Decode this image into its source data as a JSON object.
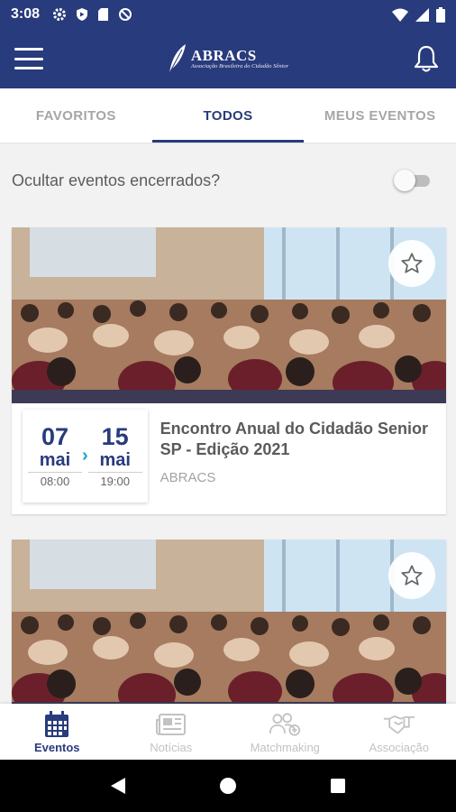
{
  "status_bar": {
    "time": "3:08"
  },
  "app_bar": {
    "logo_text": "ABRACS",
    "logo_subtitle": "Associação Brasileira do Cidadão Sênior"
  },
  "tabs": [
    {
      "label": "FAVORITOS",
      "active": false
    },
    {
      "label": "TODOS",
      "active": true
    },
    {
      "label": "MEUS EVENTOS",
      "active": false
    }
  ],
  "filter": {
    "label": "Ocultar eventos encerrados?",
    "enabled": false
  },
  "events": [
    {
      "start_day": "07",
      "start_month": "mai",
      "start_time": "08:00",
      "end_day": "15",
      "end_month": "mai",
      "end_time": "19:00",
      "title": "Encontro Anual do Cidadão Senior SP - Edição 2021",
      "organizer": "ABRACS",
      "favorite": false
    },
    {
      "favorite": false
    }
  ],
  "bottom_nav": [
    {
      "label": "Eventos",
      "icon": "calendar-icon",
      "active": true
    },
    {
      "label": "Notícias",
      "icon": "newspaper-icon",
      "active": false
    },
    {
      "label": "Matchmaking",
      "icon": "people-add-icon",
      "active": false
    },
    {
      "label": "Associação",
      "icon": "handshake-icon",
      "active": false
    }
  ],
  "colors": {
    "primary": "#283b7c",
    "accent": "#1a9fd6",
    "inactive": "#c2c2c2"
  }
}
